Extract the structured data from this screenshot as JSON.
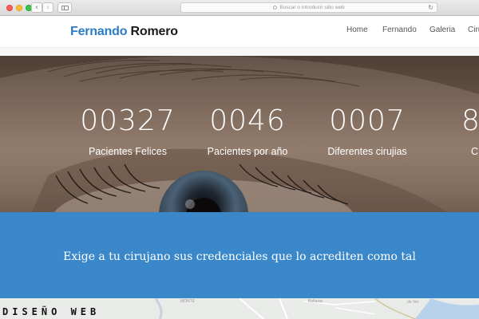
{
  "browser": {
    "address_placeholder": "Buscar o introducir sitio web"
  },
  "site": {
    "logo_first": "Fernando",
    "logo_last": "Romero",
    "menu": [
      "Home",
      "Fernando",
      "Galeria",
      "Ciru"
    ]
  },
  "hero": {
    "stats": [
      {
        "number": "00327",
        "label": "Pacientes Felices"
      },
      {
        "number": "0046",
        "label": "Pacientes por año"
      },
      {
        "number": "0007",
        "label": "Diferentes cirujias"
      },
      {
        "number": "8",
        "label": "C"
      }
    ]
  },
  "banner": {
    "text": "Exige a tu cirujano sus credenciales que lo acrediten como tal"
  },
  "map": {
    "labels": [
      "MONTE",
      "Baltazar",
      "de Ver"
    ]
  },
  "watermark": "DISEÑO WEB",
  "colors": {
    "brand_blue": "#2b7cc7",
    "banner_blue": "#3a88c9"
  }
}
